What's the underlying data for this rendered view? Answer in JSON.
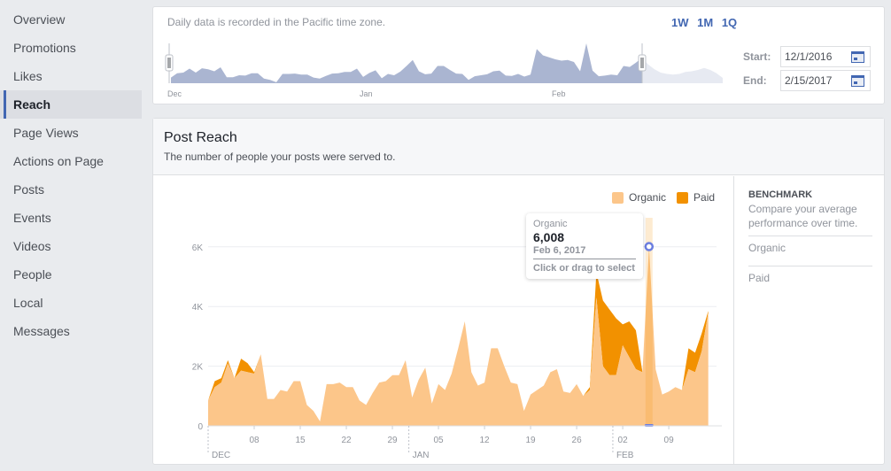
{
  "sidebar": {
    "items": [
      {
        "label": "Overview",
        "active": false
      },
      {
        "label": "Promotions",
        "active": false
      },
      {
        "label": "Likes",
        "active": false
      },
      {
        "label": "Reach",
        "active": true
      },
      {
        "label": "Page Views",
        "active": false
      },
      {
        "label": "Actions on Page",
        "active": false
      },
      {
        "label": "Posts",
        "active": false
      },
      {
        "label": "Events",
        "active": false
      },
      {
        "label": "Videos",
        "active": false
      },
      {
        "label": "People",
        "active": false
      },
      {
        "label": "Local",
        "active": false
      },
      {
        "label": "Messages",
        "active": false
      }
    ]
  },
  "range": {
    "note": "Daily data is recorded in the Pacific time zone.",
    "presets": [
      "1W",
      "1M",
      "1Q"
    ],
    "start_label": "Start:",
    "start_value": "12/1/2016",
    "end_label": "End:",
    "end_value": "2/15/2017",
    "mini_months": [
      "Dec",
      "Jan",
      "Feb"
    ],
    "colors": {
      "selected": "#aab5d1",
      "unselected": "#e7eaf2"
    }
  },
  "reach": {
    "title": "Post Reach",
    "subtitle": "The number of people your posts were served to.",
    "legend": [
      {
        "name": "Organic",
        "color": "#fcc68a"
      },
      {
        "name": "Paid",
        "color": "#f29100"
      }
    ],
    "tooltip": {
      "series": "Organic",
      "value": "6,008",
      "date": "Feb 6, 2017",
      "hint": "Click or drag to select"
    },
    "benchmark": {
      "title": "BENCHMARK",
      "desc": "Compare your average performance over time.",
      "items": [
        "Organic",
        "Paid"
      ]
    }
  },
  "chart_data": {
    "type": "area",
    "title": "Post Reach",
    "xlabel": "",
    "ylabel": "",
    "ylim": [
      0,
      6500
    ],
    "y_ticks": [
      "0",
      "2K",
      "4K",
      "6K"
    ],
    "x_ticks": [
      "08",
      "15",
      "22",
      "29",
      "05",
      "12",
      "19",
      "26",
      "02",
      "09"
    ],
    "month_labels": [
      "DEC",
      "JAN",
      "FEB"
    ],
    "x_start": "2016-12-01",
    "x_end": "2017-02-15",
    "grid": true,
    "legend_position": "top-right",
    "stacked": true,
    "highlight_index": 67,
    "series": [
      {
        "name": "Organic",
        "values": [
          850,
          1300,
          1450,
          2100,
          1600,
          1850,
          1800,
          1750,
          2400,
          900,
          900,
          1200,
          1150,
          1500,
          1500,
          700,
          500,
          150,
          1400,
          1400,
          1450,
          1300,
          1300,
          850,
          700,
          1100,
          1450,
          1500,
          1700,
          1700,
          2200,
          950,
          1550,
          1950,
          750,
          1400,
          1200,
          1750,
          2600,
          3500,
          1800,
          1350,
          1450,
          2600,
          2600,
          2000,
          1450,
          1400,
          500,
          1050,
          1200,
          1350,
          1800,
          1900,
          1150,
          1100,
          1400,
          1000,
          1200,
          4300,
          2000,
          1700,
          1700,
          2700,
          2300,
          1900,
          1800,
          6008,
          1900,
          1050,
          1150,
          1300,
          1200,
          1900,
          1800,
          2500,
          3800
        ],
        "values_note": "total stack top shown as Organic+Paid"
      },
      {
        "name": "Paid",
        "values": [
          0,
          200,
          150,
          100,
          0,
          400,
          300,
          50,
          0,
          0,
          0,
          0,
          0,
          0,
          0,
          0,
          0,
          0,
          0,
          0,
          0,
          0,
          0,
          0,
          0,
          0,
          0,
          0,
          0,
          0,
          0,
          0,
          0,
          0,
          0,
          0,
          0,
          0,
          0,
          0,
          0,
          0,
          0,
          0,
          0,
          0,
          0,
          0,
          0,
          0,
          0,
          0,
          0,
          0,
          0,
          0,
          0,
          0,
          100,
          850,
          2200,
          2200,
          1900,
          700,
          1200,
          1300,
          0,
          0,
          0,
          0,
          0,
          0,
          0,
          700,
          650,
          600,
          50
        ]
      }
    ]
  }
}
